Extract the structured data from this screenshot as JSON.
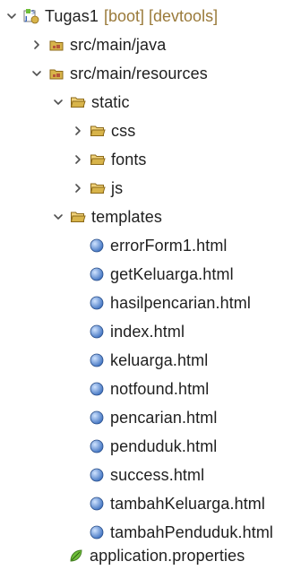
{
  "project": {
    "name": "Tugas1",
    "decorations": "[boot] [devtools]",
    "icon": "spring-project-icon"
  },
  "tree": [
    {
      "label": "src/main/java",
      "icon": "package-folder-icon",
      "expanded": false,
      "level": 1
    },
    {
      "label": "src/main/resources",
      "icon": "package-folder-icon",
      "expanded": true,
      "level": 1
    },
    {
      "label": "static",
      "icon": "folder-open-icon",
      "expanded": true,
      "level": 2
    },
    {
      "label": "css",
      "icon": "folder-open-icon",
      "expanded": false,
      "level": 3
    },
    {
      "label": "fonts",
      "icon": "folder-open-icon",
      "expanded": false,
      "level": 3
    },
    {
      "label": "js",
      "icon": "folder-open-icon",
      "expanded": false,
      "level": 3
    },
    {
      "label": "templates",
      "icon": "folder-open-icon",
      "expanded": true,
      "level": 2
    }
  ],
  "template_files": [
    "errorForm1.html",
    "getKeluarga.html",
    "hasilpencarian.html",
    "index.html",
    "keluarga.html",
    "notfound.html",
    "pencarian.html",
    "penduduk.html",
    "success.html",
    "tambahKeluarga.html",
    "tambahPenduduk.html"
  ],
  "properties_file": {
    "label": "application.properties",
    "icon": "leaf-properties-icon"
  },
  "colors": {
    "folder": "#d8b44a",
    "folder_stroke": "#8c6a1a",
    "html_file": "#5a8fd8",
    "chevron": "#505050",
    "decorations": "#9a7a3a",
    "leaf": "#6fbf3a"
  }
}
